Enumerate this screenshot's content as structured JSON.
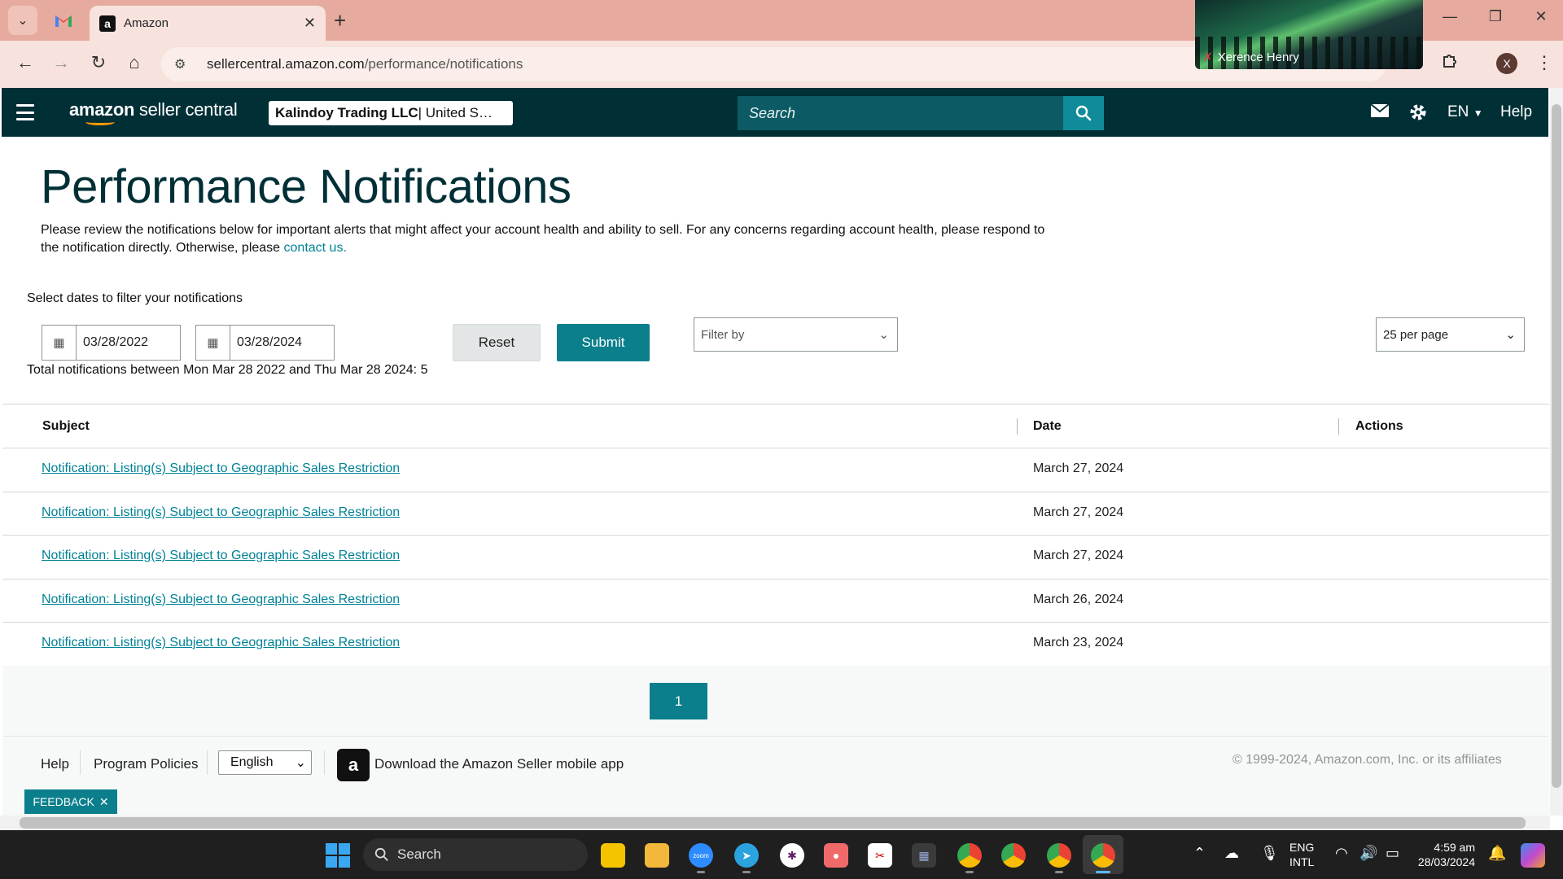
{
  "browser": {
    "tab_title": "Amazon",
    "tab_favicon": "a",
    "url_host": "sellercentral.amazon.com",
    "url_path": "/performance/notifications",
    "profile_initial": "X",
    "video_participant": "Xerence Henry"
  },
  "header": {
    "logo_bold": "amazon",
    "logo_rest": " seller central",
    "account_name": "Kalindoy Trading LLC",
    "account_marketplace": " | United S…",
    "search_placeholder": "Search",
    "language": "EN",
    "help": "Help"
  },
  "page": {
    "title": "Performance Notifications",
    "intro_text": "Please review the notifications below for important alerts that might affect your account health and ability to sell. For any concerns regarding account health, please respond to the notification directly. Otherwise, please ",
    "intro_link": "contact us.",
    "filter_label": "Select dates to filter your notifications",
    "date_from": "03/28/2022",
    "date_to": "03/28/2024",
    "reset_label": "Reset",
    "submit_label": "Submit",
    "filter_by_placeholder": "Filter by",
    "per_page": "25 per page",
    "total_line": "Total notifications between Mon Mar 28 2022 and Thu Mar 28 2024: 5"
  },
  "table": {
    "headers": [
      "Subject",
      "Date",
      "Actions"
    ],
    "rows": [
      {
        "subject": "Notification: Listing(s) Subject to Geographic Sales Restriction",
        "date": "March 27, 2024"
      },
      {
        "subject": "Notification: Listing(s) Subject to Geographic Sales Restriction",
        "date": "March 27, 2024"
      },
      {
        "subject": "Notification: Listing(s) Subject to Geographic Sales Restriction",
        "date": "March 27, 2024"
      },
      {
        "subject": "Notification: Listing(s) Subject to Geographic Sales Restriction",
        "date": "March 26, 2024"
      },
      {
        "subject": "Notification: Listing(s) Subject to Geographic Sales Restriction",
        "date": "March 23, 2024"
      }
    ]
  },
  "pagination": {
    "current_page": "1"
  },
  "footer": {
    "help": "Help",
    "program_policies": "Program Policies",
    "language": "English",
    "app_download": "Download the Amazon Seller mobile app",
    "copyright": "© 1999-2024, Amazon.com, Inc. or its affiliates",
    "feedback": "FEEDBACK"
  },
  "taskbar": {
    "search_label": "Search",
    "lang_top": "ENG",
    "lang_bottom": "INTL",
    "time": "4:59 am",
    "date": "28/03/2024"
  },
  "colors": {
    "header_bg": "#002f36",
    "accent_teal": "#0b7f8c",
    "link": "#008296",
    "tab_strip": "#e6ab9e"
  }
}
